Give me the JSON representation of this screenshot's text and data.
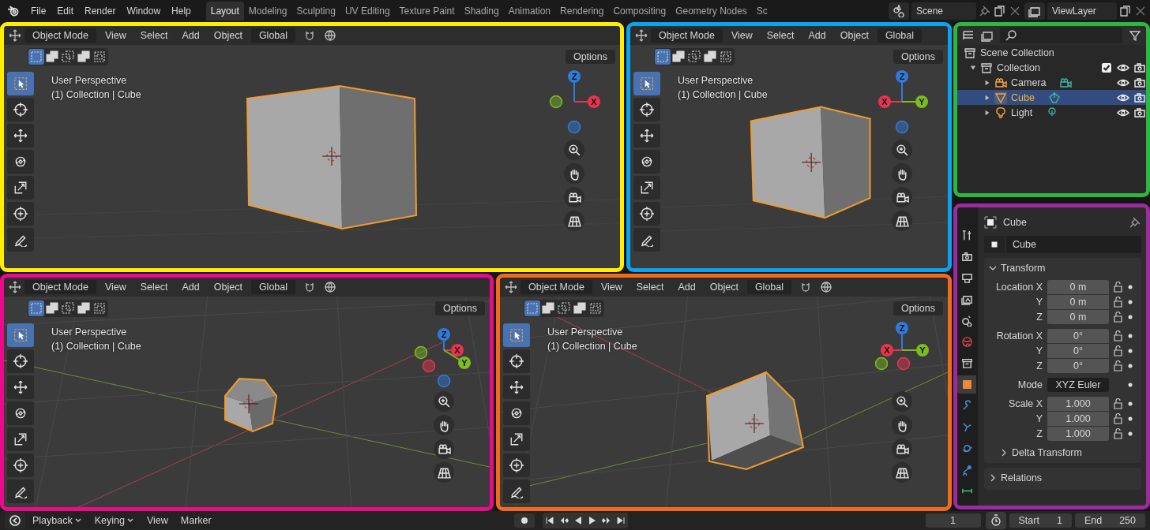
{
  "topbar": {
    "menus": [
      "File",
      "Edit",
      "Render",
      "Window",
      "Help"
    ],
    "workspaces": [
      {
        "label": "Layout",
        "selected": true
      },
      {
        "label": "Modeling",
        "selected": false
      },
      {
        "label": "Sculpting",
        "selected": false
      },
      {
        "label": "UV Editing",
        "selected": false
      },
      {
        "label": "Texture Paint",
        "selected": false
      },
      {
        "label": "Shading",
        "selected": false
      },
      {
        "label": "Animation",
        "selected": false
      },
      {
        "label": "Rendering",
        "selected": false
      },
      {
        "label": "Compositing",
        "selected": false
      },
      {
        "label": "Geometry Nodes",
        "selected": false
      },
      {
        "label": "Sc",
        "selected": false
      }
    ],
    "scene": "Scene",
    "view_layer": "ViewLayer"
  },
  "viewports": [
    {
      "color": "#ffee00",
      "kind": "front",
      "mode": "Object Mode",
      "menus": [
        "View",
        "Select",
        "Add",
        "Object"
      ],
      "orientation": "Global",
      "options": "Options",
      "overlay": [
        "User Perspective",
        "(1) Collection | Cube"
      ],
      "select_modes": [
        {
          "selected": true
        },
        {
          "selected": false
        },
        {
          "selected": false
        },
        {
          "selected": false
        },
        {
          "selected": false
        }
      ],
      "tools": [
        {
          "selected": true
        },
        {
          "selected": false
        },
        {
          "selected": false
        },
        {
          "selected": false
        },
        {
          "selected": false
        },
        {
          "selected": false
        },
        {
          "selected": false
        }
      ],
      "gizmo": [
        {
          "label": "Z",
          "color": "#2f7bdc"
        },
        {
          "label": "X",
          "color": "#e8344f"
        }
      ]
    },
    {
      "color": "#0aa3ee",
      "kind": "front_small",
      "mode": "Object Mode",
      "menus": [
        "View",
        "Select",
        "Add",
        "Object"
      ],
      "orientation": "Global",
      "options": "Options",
      "overlay": [
        "User Perspective",
        "(1) Collection | Cube"
      ],
      "select_modes": [
        {
          "selected": true
        },
        {
          "selected": false
        },
        {
          "selected": false
        },
        {
          "selected": false
        },
        {
          "selected": false
        }
      ],
      "tools": [
        {
          "selected": true
        },
        {
          "selected": false
        },
        {
          "selected": false
        },
        {
          "selected": false
        },
        {
          "selected": false
        },
        {
          "selected": false
        },
        {
          "selected": false
        }
      ],
      "gizmo": [
        {
          "label": "Z",
          "color": "#2f7bdc"
        },
        {
          "label": "X",
          "color": "#e8344f"
        },
        {
          "label": "Y",
          "color": "#7bbd1e"
        }
      ]
    },
    {
      "color": "#ec0a8c",
      "kind": "persp_small",
      "mode": "Object Mode",
      "menus": [
        "View",
        "Select",
        "Add",
        "Object"
      ],
      "orientation": "Global",
      "options": "Options",
      "overlay": [
        "User Perspective",
        "(1) Collection | Cube"
      ],
      "select_modes": [
        {
          "selected": true
        },
        {
          "selected": false
        },
        {
          "selected": false
        },
        {
          "selected": false
        },
        {
          "selected": false
        }
      ],
      "tools": [
        {
          "selected": true
        },
        {
          "selected": false
        },
        {
          "selected": false
        },
        {
          "selected": false
        },
        {
          "selected": false
        },
        {
          "selected": false
        },
        {
          "selected": false
        }
      ],
      "gizmo": [
        {
          "label": "Z",
          "color": "#2f7bdc"
        },
        {
          "label": "X",
          "color": "#e8344f"
        },
        {
          "label": "Y",
          "color": "#7bbd1e"
        }
      ]
    },
    {
      "color": "#f26b1d",
      "kind": "persp",
      "mode": "Object Mode",
      "menus": [
        "View",
        "Select",
        "Add",
        "Object"
      ],
      "orientation": "Global",
      "options": "Options",
      "overlay": [
        "User Perspective",
        "(1) Collection | Cube"
      ],
      "select_modes": [
        {
          "selected": true
        },
        {
          "selected": false
        },
        {
          "selected": false
        },
        {
          "selected": false
        },
        {
          "selected": false
        }
      ],
      "tools": [
        {
          "selected": true
        },
        {
          "selected": false
        },
        {
          "selected": false
        },
        {
          "selected": false
        },
        {
          "selected": false
        },
        {
          "selected": false
        },
        {
          "selected": false
        }
      ],
      "gizmo": [
        {
          "label": "Z",
          "color": "#2f7bdc"
        },
        {
          "label": "X",
          "color": "#e8344f"
        },
        {
          "label": "Y",
          "color": "#7bbd1e"
        }
      ]
    }
  ],
  "outliner": {
    "color": "#2db742",
    "tree": [
      {
        "label": "Scene Collection",
        "kind": "scene",
        "selected": false,
        "children": [
          {
            "label": "Collection",
            "kind": "collection",
            "selected": false,
            "expanded": true,
            "checked": true,
            "children": [
              {
                "label": "Camera",
                "kind": "camera",
                "selected": false,
                "expanded": false
              },
              {
                "label": "Cube",
                "kind": "mesh",
                "selected": true,
                "expanded": false
              },
              {
                "label": "Light",
                "kind": "light",
                "selected": false,
                "expanded": false
              }
            ]
          }
        ]
      }
    ]
  },
  "properties": {
    "color": "#9b2b9e",
    "tabs": [
      {
        "selected": false
      },
      {
        "selected": false
      },
      {
        "selected": false
      },
      {
        "selected": false
      },
      {
        "selected": false
      },
      {
        "selected": false
      },
      {
        "selected": false
      },
      {
        "selected": true
      },
      {
        "selected": false
      },
      {
        "selected": false
      },
      {
        "selected": false
      },
      {
        "selected": false
      },
      {
        "selected": false
      }
    ],
    "object": "Cube",
    "datablock": "Cube",
    "transform": {
      "title": "Transform",
      "expanded": true,
      "groups": [
        {
          "rows": [
            {
              "label": "Location X",
              "value": "0 m",
              "kind": "number"
            },
            {
              "label": "Y",
              "value": "0 m",
              "kind": "number"
            },
            {
              "label": "Z",
              "value": "0 m",
              "kind": "number"
            }
          ]
        },
        {
          "rows": [
            {
              "label": "Rotation X",
              "value": "0°",
              "kind": "number"
            },
            {
              "label": "Y",
              "value": "0°",
              "kind": "number"
            },
            {
              "label": "Z",
              "value": "0°",
              "kind": "number"
            }
          ]
        },
        {
          "rows": [
            {
              "label": "Mode",
              "value": "XYZ Euler",
              "kind": "dropdown"
            }
          ]
        },
        {
          "rows": [
            {
              "label": "Scale X",
              "value": "1.000",
              "kind": "number"
            },
            {
              "label": "Y",
              "value": "1.000",
              "kind": "number"
            },
            {
              "label": "Z",
              "value": "1.000",
              "kind": "number"
            }
          ]
        }
      ],
      "subpanel": {
        "title": "Delta Transform",
        "expanded": false
      }
    },
    "panels": [
      {
        "title": "Relations",
        "expanded": false
      }
    ]
  },
  "timeline": {
    "menus": [
      {
        "label": "Playback",
        "dropdown": true
      },
      {
        "label": "Keying",
        "dropdown": true
      },
      {
        "label": "View",
        "dropdown": false
      },
      {
        "label": "Marker",
        "dropdown": false
      }
    ],
    "current_frame": "1",
    "start_label": "Start",
    "start": "1",
    "end_label": "End",
    "end": "250"
  }
}
